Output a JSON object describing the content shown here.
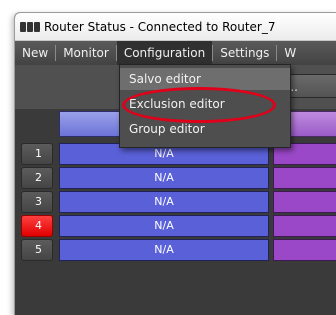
{
  "window": {
    "title": "Router Status - Connected to Router_7"
  },
  "menubar": {
    "items": [
      "New",
      "Monitor",
      "Configuration",
      "Settings",
      "W"
    ]
  },
  "toolbar": {
    "button_label": "ions..."
  },
  "dropdown": {
    "items": [
      "Salvo editor",
      "Exclusion editor",
      "Group editor"
    ]
  },
  "grid": {
    "rows": [
      {
        "number": "1",
        "value": "N/A"
      },
      {
        "number": "2",
        "value": "N/A"
      },
      {
        "number": "3",
        "value": "N/A"
      },
      {
        "number": "4",
        "value": "N/A",
        "alert": true
      },
      {
        "number": "5",
        "value": "N/A"
      }
    ]
  },
  "colors": {
    "menubar": "#4a4a4a",
    "highlight_ellipse": "#e0001a",
    "blue_column": "#5a60d8",
    "purple_column": "#9a48c8",
    "alert_row": "#ff2020"
  },
  "icons": {
    "app": "router-app-icon"
  }
}
